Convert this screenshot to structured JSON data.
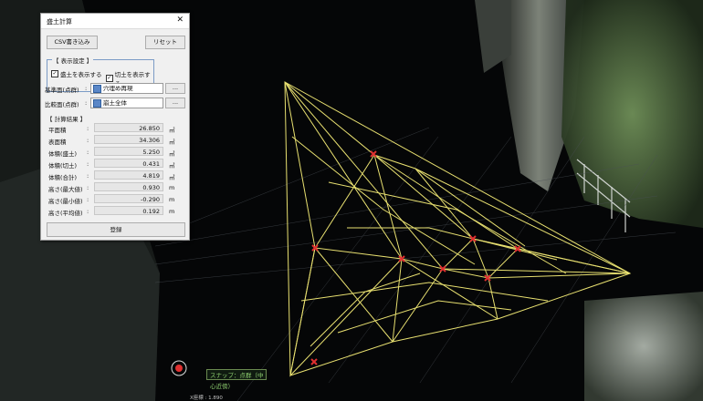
{
  "dialog": {
    "title": "盛土計算",
    "close_glyph": "✕",
    "csv_button": "CSV書き込み",
    "reset_button": "リセット",
    "display_group": {
      "title": "【 表示設定 】",
      "fill_checkbox": {
        "label": "盛土を表示する",
        "checked": true
      },
      "cut_checkbox": {
        "label": "切土を表示する",
        "checked": true
      }
    },
    "base_surface": {
      "label": "基準面(点群)",
      "value": "穴埋め再現",
      "browse": "..."
    },
    "compare_surface": {
      "label": "比較面(点群)",
      "value": "崩土全体",
      "browse": "..."
    },
    "results_title": "【 計算結果 】",
    "results": [
      {
        "label": "平面積",
        "value": "26.850",
        "unit": "㎡"
      },
      {
        "label": "表面積",
        "value": "34.306",
        "unit": "㎡"
      },
      {
        "label": "体積(盛土)",
        "value": "5.250",
        "unit": "㎥"
      },
      {
        "label": "体積(切土)",
        "value": "0.431",
        "unit": "㎥"
      },
      {
        "label": "体積(合計)",
        "value": "4.819",
        "unit": "㎥"
      },
      {
        "label": "高さ(最大値)",
        "value": "0.930",
        "unit": "m"
      },
      {
        "label": "高さ(最小値)",
        "value": "-0.290",
        "unit": "m"
      },
      {
        "label": "高さ(平均値)",
        "value": "0.192",
        "unit": "m"
      }
    ],
    "register_button": "登録"
  },
  "viewport": {
    "snap_label": "スナップ：点群（中心近傍）",
    "coord_readout": "X座標 :        1.890"
  },
  "colors": {
    "mesh": "#e8e070",
    "marker": "#e03030",
    "background": "#050607"
  },
  "icons": [
    "close-icon",
    "checkbox-icon",
    "folder-icon",
    "snap-target-icon",
    "point-marker-icon"
  ]
}
